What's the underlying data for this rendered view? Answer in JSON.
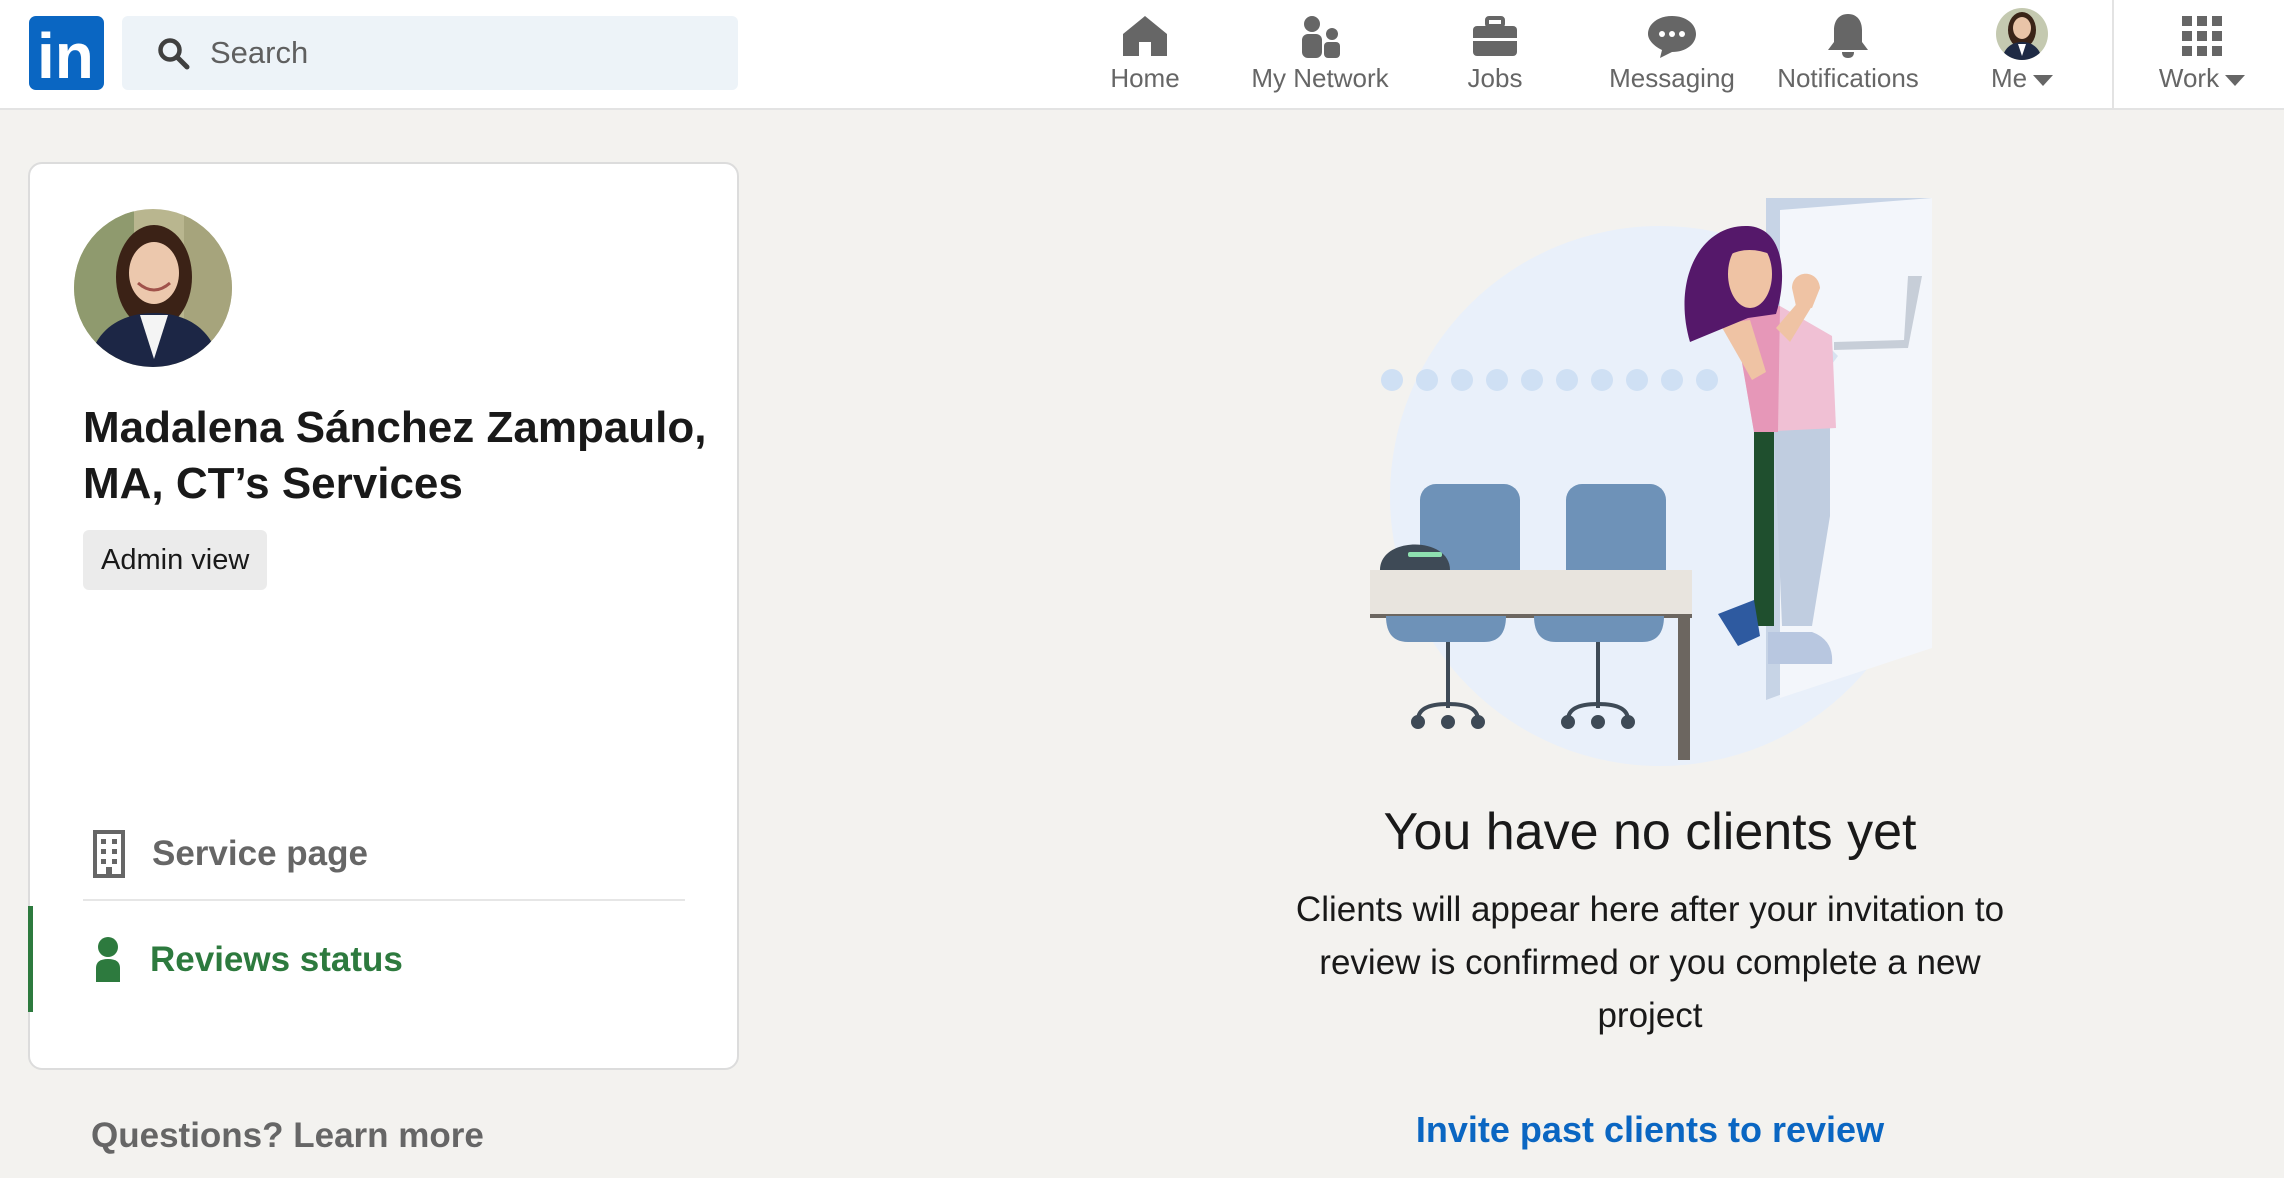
{
  "nav": {
    "logo_text": "in",
    "search_placeholder": "Search",
    "items": [
      {
        "label": "Home",
        "icon": "home-icon"
      },
      {
        "label": "My Network",
        "icon": "people-icon"
      },
      {
        "label": "Jobs",
        "icon": "briefcase-icon"
      },
      {
        "label": "Messaging",
        "icon": "chat-bubble-icon"
      },
      {
        "label": "Notifications",
        "icon": "bell-icon"
      },
      {
        "label": "Me",
        "icon": "avatar"
      },
      {
        "label": "Work",
        "icon": "grid-icon"
      }
    ]
  },
  "profile": {
    "name": "Madalena Sánchez Zampaulo, MA, CT’s Services",
    "badge": "Admin view"
  },
  "menu": {
    "service_page": "Service page",
    "reviews_status": "Reviews status"
  },
  "learn_more": "Questions? Learn more",
  "empty_state": {
    "title": "You have no clients yet",
    "description": "Clients will appear here after your invitation to review is confirmed or you complete a new project",
    "cta": "Invite past clients to review"
  },
  "colors": {
    "brand": "#0a66c2",
    "active": "#2d7a3e",
    "background": "#f3f2ef"
  }
}
